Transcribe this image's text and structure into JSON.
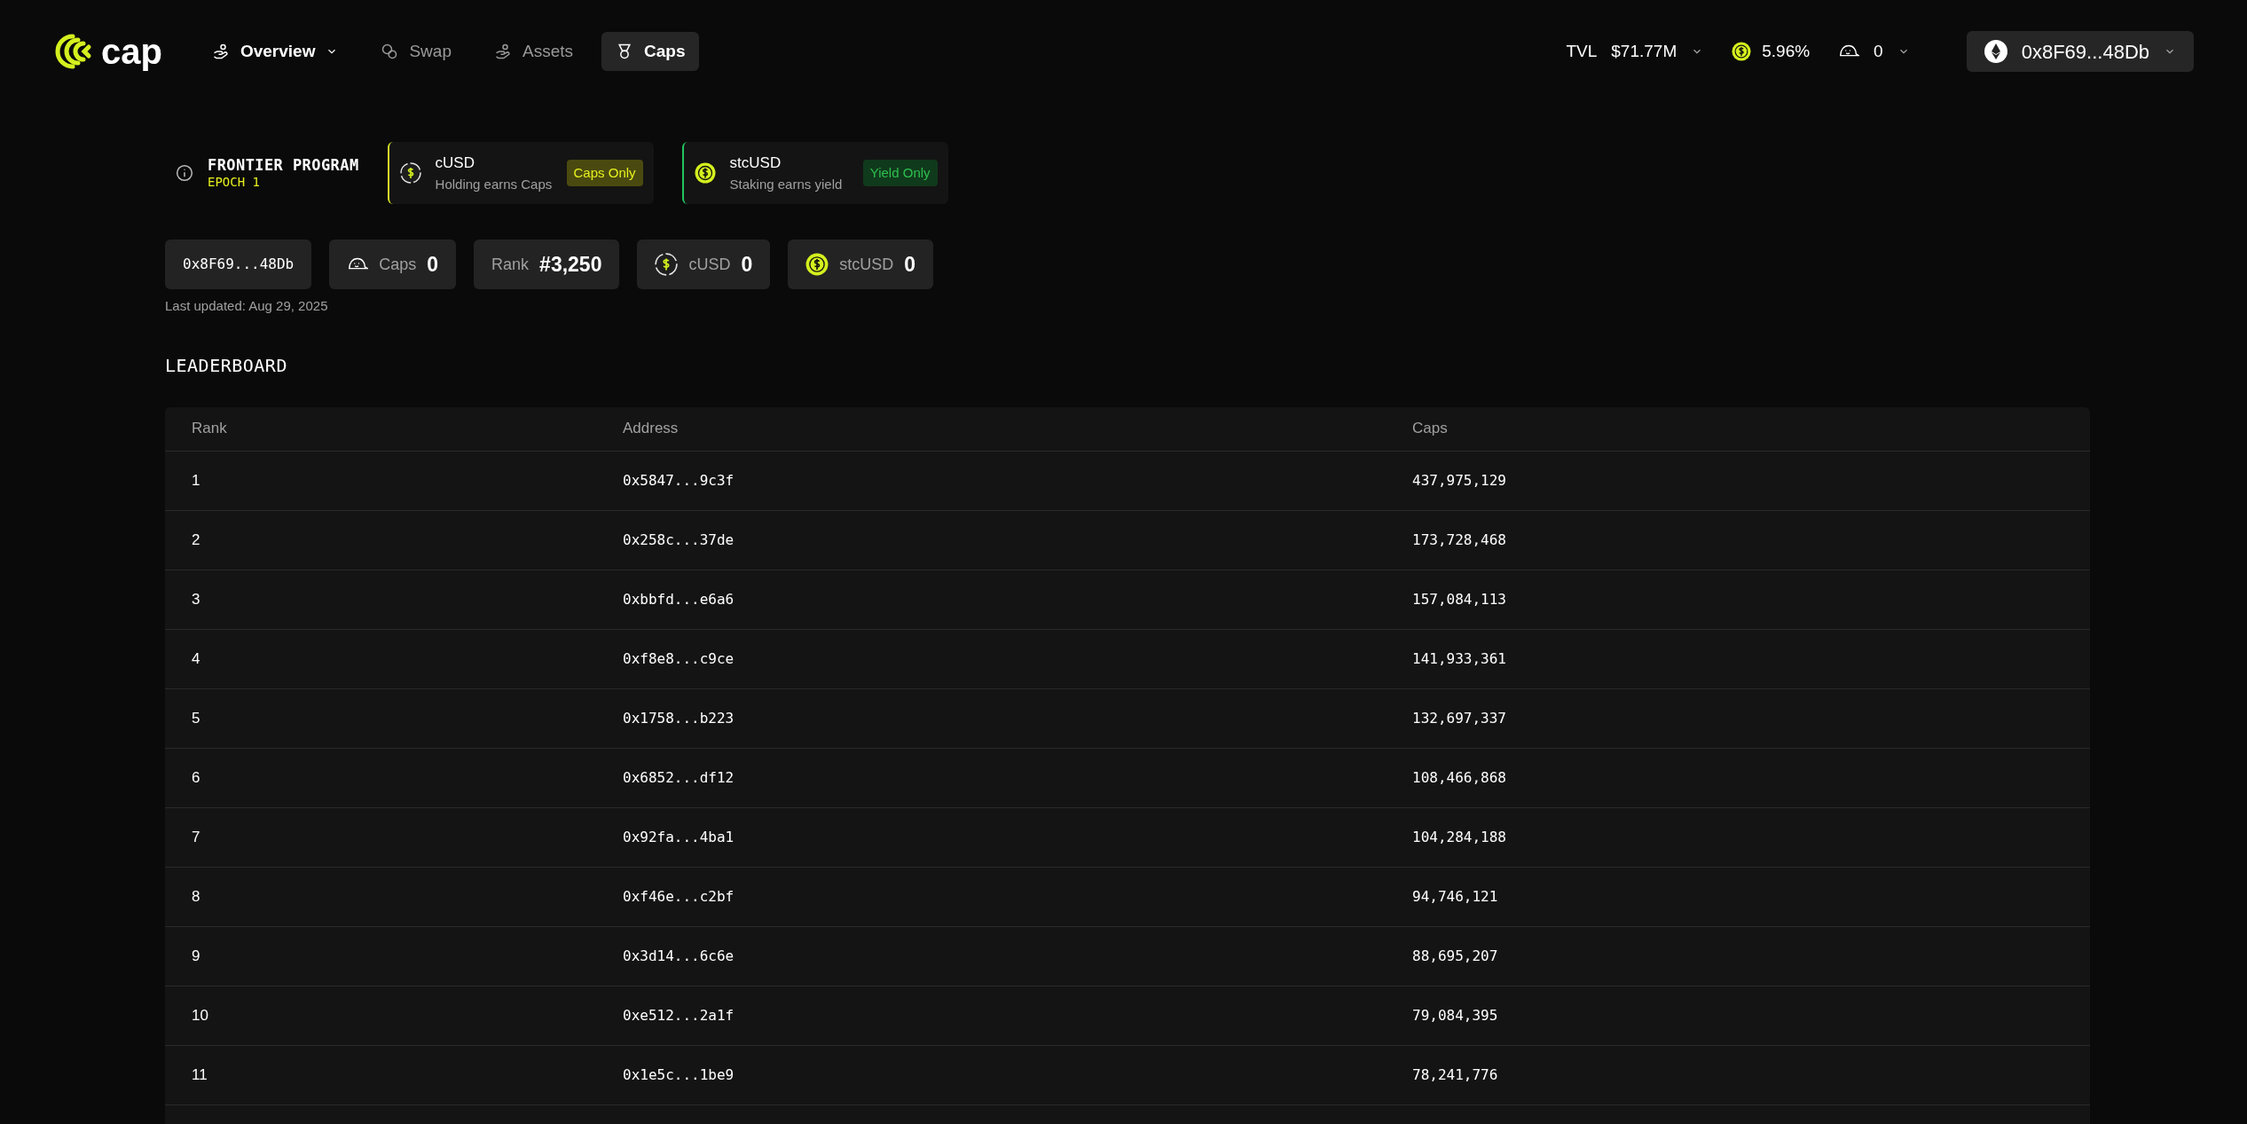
{
  "logo": {
    "text": "cap"
  },
  "nav": [
    {
      "label": "Overview",
      "kind": "hand",
      "dropdown": true,
      "selected": false,
      "bold": true
    },
    {
      "label": "Swap",
      "kind": "coins",
      "dropdown": false,
      "selected": false,
      "bold": false
    },
    {
      "label": "Assets",
      "kind": "hand",
      "dropdown": false,
      "selected": false,
      "bold": false
    },
    {
      "label": "Caps",
      "kind": "medal",
      "dropdown": false,
      "selected": true,
      "bold": true
    }
  ],
  "header_stats": {
    "tvl_label": "TVL",
    "tvl_value": "$71.77M",
    "apy": "5.96%",
    "caps": "0"
  },
  "wallet": {
    "address": "0x8F69...48Db"
  },
  "program": {
    "title": "FRONTIER PROGRAM",
    "epoch": "EPOCH 1"
  },
  "tokens": [
    {
      "name": "cUSD",
      "description": "Holding earns Caps",
      "badge": "Caps Only",
      "color": "#d4e02a",
      "kind": "ring"
    },
    {
      "name": "stcUSD",
      "description": "Staking earns yield",
      "badge": "Yield Only",
      "color": "#22c55e",
      "kind": "solid"
    }
  ],
  "stats": [
    {
      "kind": "address",
      "value": "0x8F69...48Db"
    },
    {
      "kind": "caps",
      "label": "Caps",
      "value": "0"
    },
    {
      "kind": "rank",
      "label": "Rank",
      "value": "#3,250"
    },
    {
      "kind": "ring",
      "label": "cUSD",
      "value": "0"
    },
    {
      "kind": "solid",
      "label": "stcUSD",
      "value": "0"
    }
  ],
  "last_updated": "Last updated: Aug 29, 2025",
  "leaderboard": {
    "title": "LEADERBOARD",
    "columns": [
      "Rank",
      "Address",
      "Caps"
    ],
    "rows": [
      [
        "1",
        "0x5847...9c3f",
        "437,975,129"
      ],
      [
        "2",
        "0x258c...37de",
        "173,728,468"
      ],
      [
        "3",
        "0xbbfd...e6a6",
        "157,084,113"
      ],
      [
        "4",
        "0xf8e8...c9ce",
        "141,933,361"
      ],
      [
        "5",
        "0x1758...b223",
        "132,697,337"
      ],
      [
        "6",
        "0x6852...df12",
        "108,466,868"
      ],
      [
        "7",
        "0x92fa...4ba1",
        "104,284,188"
      ],
      [
        "8",
        "0xf46e...c2bf",
        "94,746,121"
      ],
      [
        "9",
        "0x3d14...6c6e",
        "88,695,207"
      ],
      [
        "10",
        "0xe512...2a1f",
        "79,084,395"
      ],
      [
        "11",
        "0x1e5c...1be9",
        "78,241,776"
      ]
    ]
  }
}
